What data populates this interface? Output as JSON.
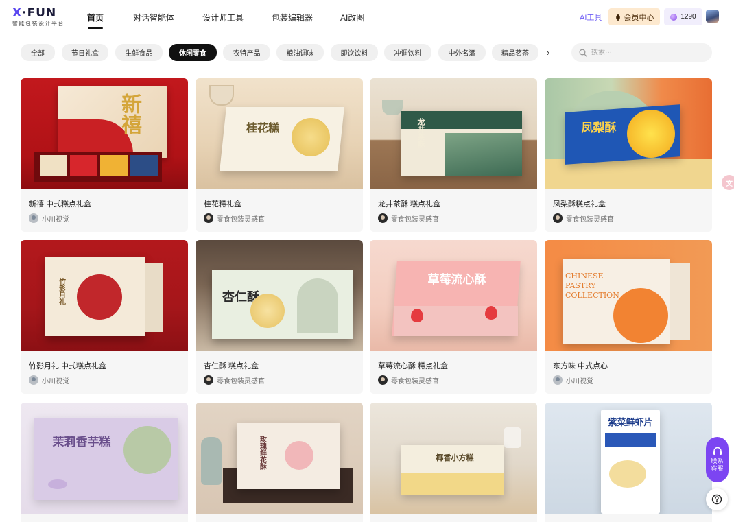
{
  "header": {
    "logo": {
      "main": "X·FUN",
      "sub": "智能包装设计平台"
    },
    "nav": [
      {
        "label": "首页",
        "active": true
      },
      {
        "label": "对话智能体",
        "active": false
      },
      {
        "label": "设计师工具",
        "active": false
      },
      {
        "label": "包装编辑器",
        "active": false
      },
      {
        "label": "AI改图",
        "active": false
      }
    ],
    "ai_tools_label": "AI工具",
    "vip_label": "会员中心",
    "points": "1290",
    "accent_color": "#5b48f0"
  },
  "categories": {
    "items": [
      {
        "label": "全部",
        "active": false
      },
      {
        "label": "节日礼盒",
        "active": false
      },
      {
        "label": "生鲜食品",
        "active": false
      },
      {
        "label": "休闲零食",
        "active": true
      },
      {
        "label": "农特产品",
        "active": false
      },
      {
        "label": "粮油调味",
        "active": false
      },
      {
        "label": "即饮饮料",
        "active": false
      },
      {
        "label": "冲调饮料",
        "active": false
      },
      {
        "label": "中外名酒",
        "active": false
      },
      {
        "label": "精品茗茶",
        "active": false
      }
    ],
    "next_icon": "chevron-right-icon"
  },
  "search": {
    "placeholder": "搜索···"
  },
  "cards": [
    {
      "title": "新禧 中式糕点礼盒",
      "author": "小川视觉",
      "box_text": "新禧"
    },
    {
      "title": "桂花糕礼盒",
      "author": "零食包装灵感官",
      "box_text": "桂花糕"
    },
    {
      "title": "龙井茶酥 糕点礼盒",
      "author": "零食包装灵感官",
      "box_text": "龙井茶酥"
    },
    {
      "title": "凤梨酥糕点礼盒",
      "author": "零食包装灵感官",
      "box_text": "凤梨酥"
    },
    {
      "title": "竹影月礼 中式糕点礼盒",
      "author": "小川视觉",
      "box_text": "竹影月礼"
    },
    {
      "title": "杏仁酥 糕点礼盒",
      "author": "零食包装灵感官",
      "box_text": "杏仁酥"
    },
    {
      "title": "草莓流心酥 糕点礼盒",
      "author": "零食包装灵感官",
      "box_text": "草莓流心酥"
    },
    {
      "title": "东方味 中式点心",
      "author": "小川视觉",
      "box_text": "CHINESE PASTRY COLLECTION"
    },
    {
      "title": "",
      "author": "",
      "box_text": "茉莉香芋糕"
    },
    {
      "title": "",
      "author": "",
      "box_text": "玫瑰鲜花酥"
    },
    {
      "title": "",
      "author": "",
      "box_text": "椰香小方糕"
    },
    {
      "title": "",
      "author": "",
      "box_text": "紫菜鲜虾片"
    }
  ],
  "floating": {
    "customer_service": "联系客服",
    "help_icon": "question-icon",
    "translate_icon": "translate-icon"
  }
}
